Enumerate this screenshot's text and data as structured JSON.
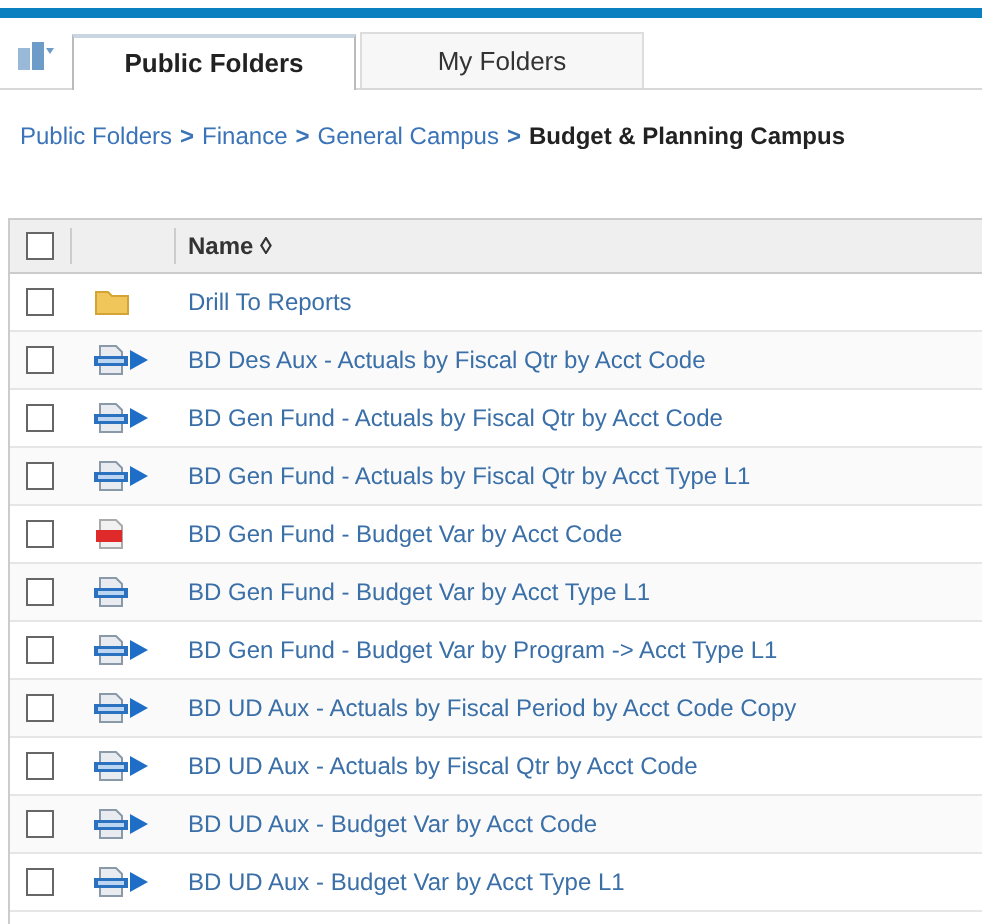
{
  "tabs": [
    {
      "label": "Public Folders",
      "selected": true
    },
    {
      "label": "My Folders",
      "selected": false
    }
  ],
  "breadcrumb": [
    {
      "label": "Public Folders",
      "current": false
    },
    {
      "label": "Finance",
      "current": false
    },
    {
      "label": "General Campus",
      "current": false
    },
    {
      "label": "Budget & Planning Campus",
      "current": true
    }
  ],
  "separator": ">",
  "table": {
    "columns": [
      "Name ◊"
    ],
    "all_checked": false,
    "rows": [
      {
        "kind": "folder",
        "name": "Drill To Reports",
        "checked": false
      },
      {
        "kind": "report_view",
        "name": "BD Des Aux - Actuals by Fiscal Qtr by Acct Code",
        "checked": false
      },
      {
        "kind": "report_view",
        "name": "BD Gen Fund - Actuals by Fiscal Qtr by Acct Code",
        "checked": false
      },
      {
        "kind": "report_view",
        "name": "BD Gen Fund - Actuals by Fiscal Qtr by Acct Type L1",
        "checked": false
      },
      {
        "kind": "pdf",
        "name": "BD Gen Fund - Budget Var by Acct Code",
        "checked": false
      },
      {
        "kind": "report",
        "name": "BD Gen Fund - Budget Var by Acct Type L1",
        "checked": false
      },
      {
        "kind": "report_view",
        "name": "BD Gen Fund - Budget Var by Program -> Acct Type L1",
        "checked": false
      },
      {
        "kind": "report_view",
        "name": "BD UD Aux - Actuals by Fiscal Period by Acct Code Copy",
        "checked": false
      },
      {
        "kind": "report_view",
        "name": "BD UD Aux - Actuals by Fiscal Qtr by Acct Code",
        "checked": false
      },
      {
        "kind": "report_view",
        "name": "BD UD Aux - Budget Var by Acct Code",
        "checked": false
      },
      {
        "kind": "report_view",
        "name": "BD UD Aux - Budget Var by Acct Type L1",
        "checked": false
      }
    ]
  }
}
